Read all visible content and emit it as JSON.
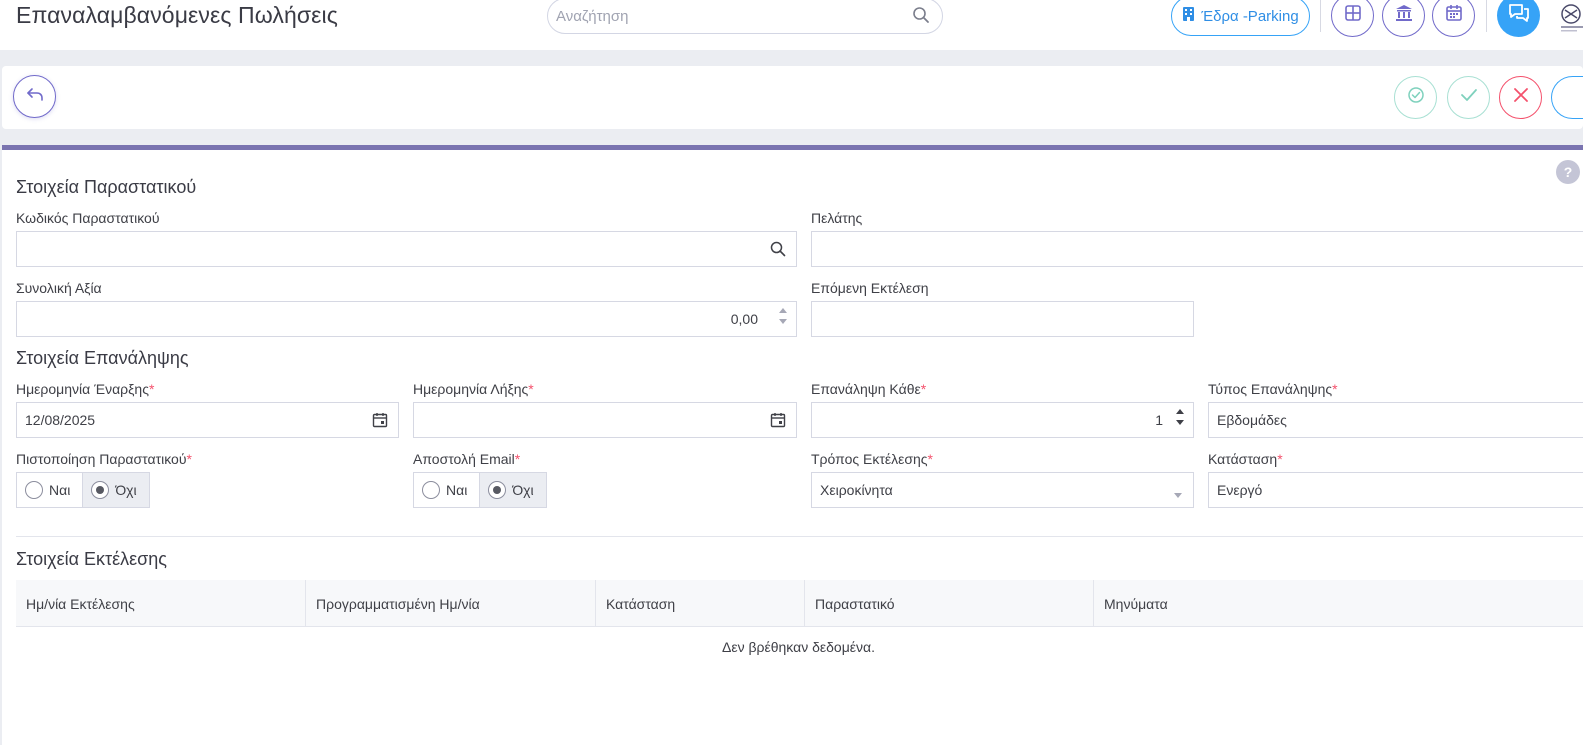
{
  "header": {
    "title": "Επαναλαμβανόμενες Πωλήσεις",
    "search_placeholder": "Αναζήτηση",
    "branch_label": "Έδρα -Parking",
    "icons": [
      "search-icon",
      "building-icon",
      "grid-icon",
      "bank-icon",
      "calendar-icon",
      "chat-icon"
    ],
    "accent": "#716aca",
    "info_color": "#36a3f7"
  },
  "toolbar": {
    "back_icon": "undo-arrow-icon",
    "actions": [
      "check-circle-icon",
      "check-icon",
      "close-icon"
    ],
    "colors": {
      "success": "#34bfa3",
      "danger": "#f4516c"
    }
  },
  "form": {
    "doc_section_title": "Στοιχεία Παραστατικού",
    "doc_code_label": "Κωδικός Παραστατικού",
    "doc_code_value": "",
    "customer_label": "Πελάτης",
    "customer_value": "",
    "total_label": "Συνολική Αξία",
    "total_value": "0,00",
    "next_run_label": "Επόμενη Εκτέλεση",
    "next_run_value": "",
    "repeat_section_title": "Στοιχεία Επανάληψης",
    "start_date_label": "Ημερομηνία Έναρξης",
    "start_date_value": "12/08/2025",
    "end_date_label": "Ημερομηνία Λήξης",
    "end_date_value": "",
    "repeat_every_label": "Επανάληψη Κάθε",
    "repeat_every_value": "1",
    "repeat_type_label": "Τύπος Επανάληψης",
    "repeat_type_value": "Εβδομάδες",
    "certify_label": "Πιστοποίηση Παραστατικού",
    "email_label": "Αποστολή Email",
    "yes_label": "Ναι",
    "no_label": "Όχι",
    "certify_selected": "Όχι",
    "email_selected": "Όχι",
    "exec_mode_label": "Τρόπος Εκτέλεσης",
    "exec_mode_value": "Χειροκίνητα",
    "status_label": "Κατάσταση",
    "status_value": "Ενεργό",
    "required_mark": "*"
  },
  "execution": {
    "section_title": "Στοιχεία Εκτέλεσης",
    "columns": [
      "Ημ/νία Εκτέλεσης",
      "Προγραμματισμένη Ημ/νία",
      "Κατάσταση",
      "Παραστατικό",
      "Μηνύματα"
    ],
    "rows": [],
    "empty_text": "Δεν βρέθηκαν δεδομένα."
  }
}
